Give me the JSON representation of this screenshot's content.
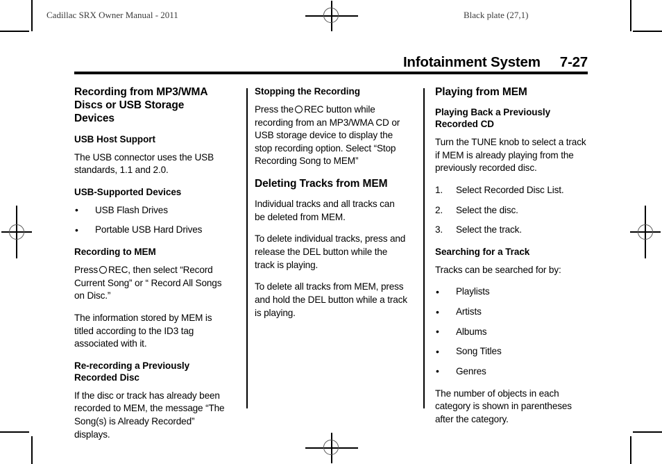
{
  "page": {
    "running_head_left": "Cadillac SRX Owner Manual - 2011",
    "running_head_right": "Black plate (27,1)",
    "chapter_title": "Infotainment System",
    "page_number": "7-27"
  },
  "column1": {
    "heading": "Recording from MP3/WMA Discs or USB Storage Devices",
    "sub1": "USB Host Support",
    "p1": "The USB connector uses the USB standards, 1.1 and 2.0.",
    "sub2": "USB-Supported Devices",
    "bullets": [
      "USB Flash Drives",
      "Portable USB Hard Drives"
    ],
    "sub3": "Recording to MEM",
    "p2_before_icon": "Press",
    "p2_after_icon": "REC, then select “Record Current Song” or “ Record All Songs on Disc.”",
    "p3": "The information stored by MEM is titled according to the ID3 tag associated with it.",
    "sub4": "Re-recording a Previously Recorded Disc",
    "p4": "If the disc or track has already been recorded to MEM, the message “The Song(s) is Already Recorded” displays."
  },
  "column2": {
    "sub1": "Stopping the Recording",
    "p1_before_icon": "Press the",
    "p1_after_icon": "REC button while recording from an MP3/WMA CD or USB storage device to display the stop recording option. Select “Stop Recording Song to MEM”",
    "heading": "Deleting Tracks from MEM",
    "p2": "Individual tracks and all tracks can be deleted from MEM.",
    "p3": "To delete individual tracks, press and release the DEL button while the track is playing.",
    "p4": "To delete all tracks from MEM, press and hold the DEL button while a track is playing."
  },
  "column3": {
    "heading": "Playing from MEM",
    "sub1": "Playing Back a Previously Recorded CD",
    "p1": "Turn the TUNE knob to select a track if MEM is already playing from the previously recorded disc.",
    "steps": [
      {
        "num": "1.",
        "text": "Select Recorded Disc List."
      },
      {
        "num": "2.",
        "text": "Select the disc."
      },
      {
        "num": "3.",
        "text": "Select the track."
      }
    ],
    "sub2": "Searching for a Track",
    "p2": "Tracks can be searched for by:",
    "bullets": [
      "Playlists",
      "Artists",
      "Albums",
      "Song Titles",
      "Genres"
    ],
    "p3": "The number of objects in each category is shown in parentheses after the category."
  },
  "icons": {
    "bullet": "•",
    "rec_circle": "record-circle-icon"
  }
}
